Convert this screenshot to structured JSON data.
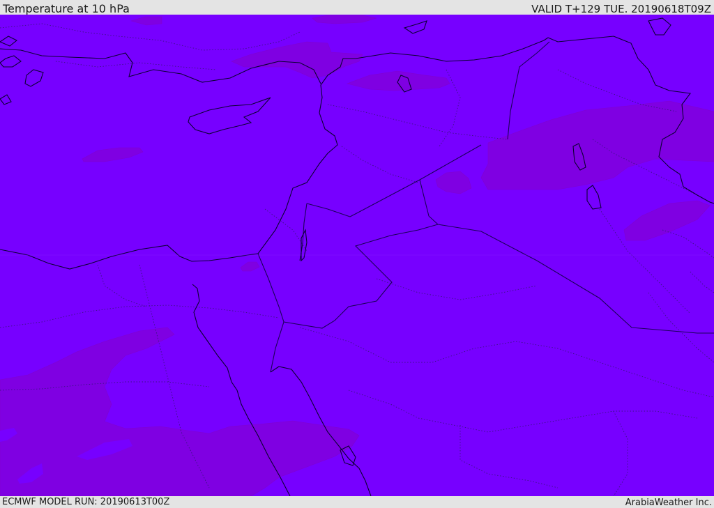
{
  "header": {
    "title": "Temperature at 10 hPa",
    "valid_time": "VALID T+129 TUE. 20190618T09Z"
  },
  "footer": {
    "model_run": "ECMWF MODEL RUN: 20190613T00Z",
    "credit": "ArabiaWeather Inc."
  },
  "map": {
    "fill_colors": {
      "base": "#7700ff",
      "warmer_patch": "#7f00e2",
      "coastline": "#0c0033",
      "border": "#1b0058"
    }
  }
}
